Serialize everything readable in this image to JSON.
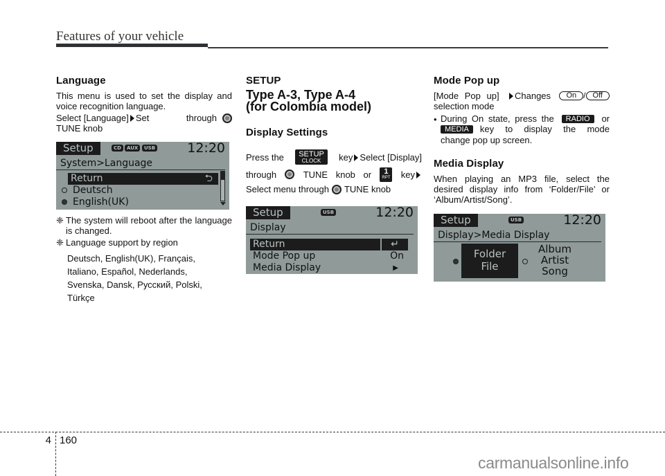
{
  "header": {
    "title": "Features of your vehicle"
  },
  "language": {
    "heading": "Language",
    "intro": "This menu is used to set the display and voice recognition language.",
    "select_text": "Select [Language]",
    "set_text": "Set through",
    "knob_text": "TUNE knob",
    "screen": {
      "tab": "Setup",
      "badges": [
        "CD",
        "AUX",
        "USB"
      ],
      "clock": "12:20",
      "path": "System>Language",
      "items": [
        {
          "label": "Return",
          "selected": true
        },
        {
          "label": "Deutsch",
          "radio": "off"
        },
        {
          "label": "English(UK)",
          "radio": "on"
        }
      ]
    },
    "notes": [
      "The system will reboot after the language is changed.",
      "Language support by region"
    ],
    "note_symbol": "❈",
    "languages_lines": [
      "Deutsch, English(UK), Français,",
      "Italiano, Español, Nederlands,",
      "Svenska, Dansk, Русский, Polski,",
      "Türkçe"
    ]
  },
  "setup": {
    "heading": "SETUP",
    "type_line1": "Type A-3, Type A-4",
    "type_line2": "(for Colombia model)",
    "display_heading": "Display Settings",
    "press_the": "Press the",
    "setup_key_top": "SETUP",
    "setup_key_bottom": "CLOCK",
    "key_select": "key",
    "select_display": "Select [Display]",
    "through": "through",
    "tune_knob_or": "TUNE knob or",
    "rpt_key_top": "1",
    "rpt_key_bottom": "RPT",
    "key": "key",
    "select_menu": "Select menu through",
    "tune_knob": "TUNE knob",
    "screen": {
      "tab": "Setup",
      "badges": [
        "USB"
      ],
      "clock": "12:20",
      "path": "Display",
      "items": [
        {
          "label": "Return",
          "value": "↵",
          "selected": true
        },
        {
          "label": "Mode Pop up",
          "value": "On"
        },
        {
          "label": "Media Display",
          "value": "▶"
        }
      ]
    }
  },
  "mode_popup": {
    "heading": "Mode Pop up",
    "line1_prefix": "[Mode Pop up]",
    "line1_changes": "Changes",
    "on_label": "On",
    "off_label": "Off",
    "selection_mode": "selection mode",
    "bullet_pre": "During On state, press the",
    "radio_key": "RADIO",
    "or": "or",
    "media_key": "MEDIA",
    "bullet_post1": "key to display the mode",
    "bullet_post2": "change pop up screen."
  },
  "media_display": {
    "heading": "Media Display",
    "text": "When playing an MP3 file, select the desired display info from ‘Folder/File’ or ‘Album/Artist/Song’.",
    "screen": {
      "tab": "Setup",
      "badges": [
        "USB"
      ],
      "clock": "12:20",
      "path": "Display>Media Display",
      "option1": [
        "Folder",
        "File"
      ],
      "option2": [
        "Album",
        "Artist",
        "Song"
      ],
      "selected_option": 1
    }
  },
  "footer": {
    "chapter": "4",
    "page": "160",
    "watermark": "carmanualsonline.info"
  }
}
